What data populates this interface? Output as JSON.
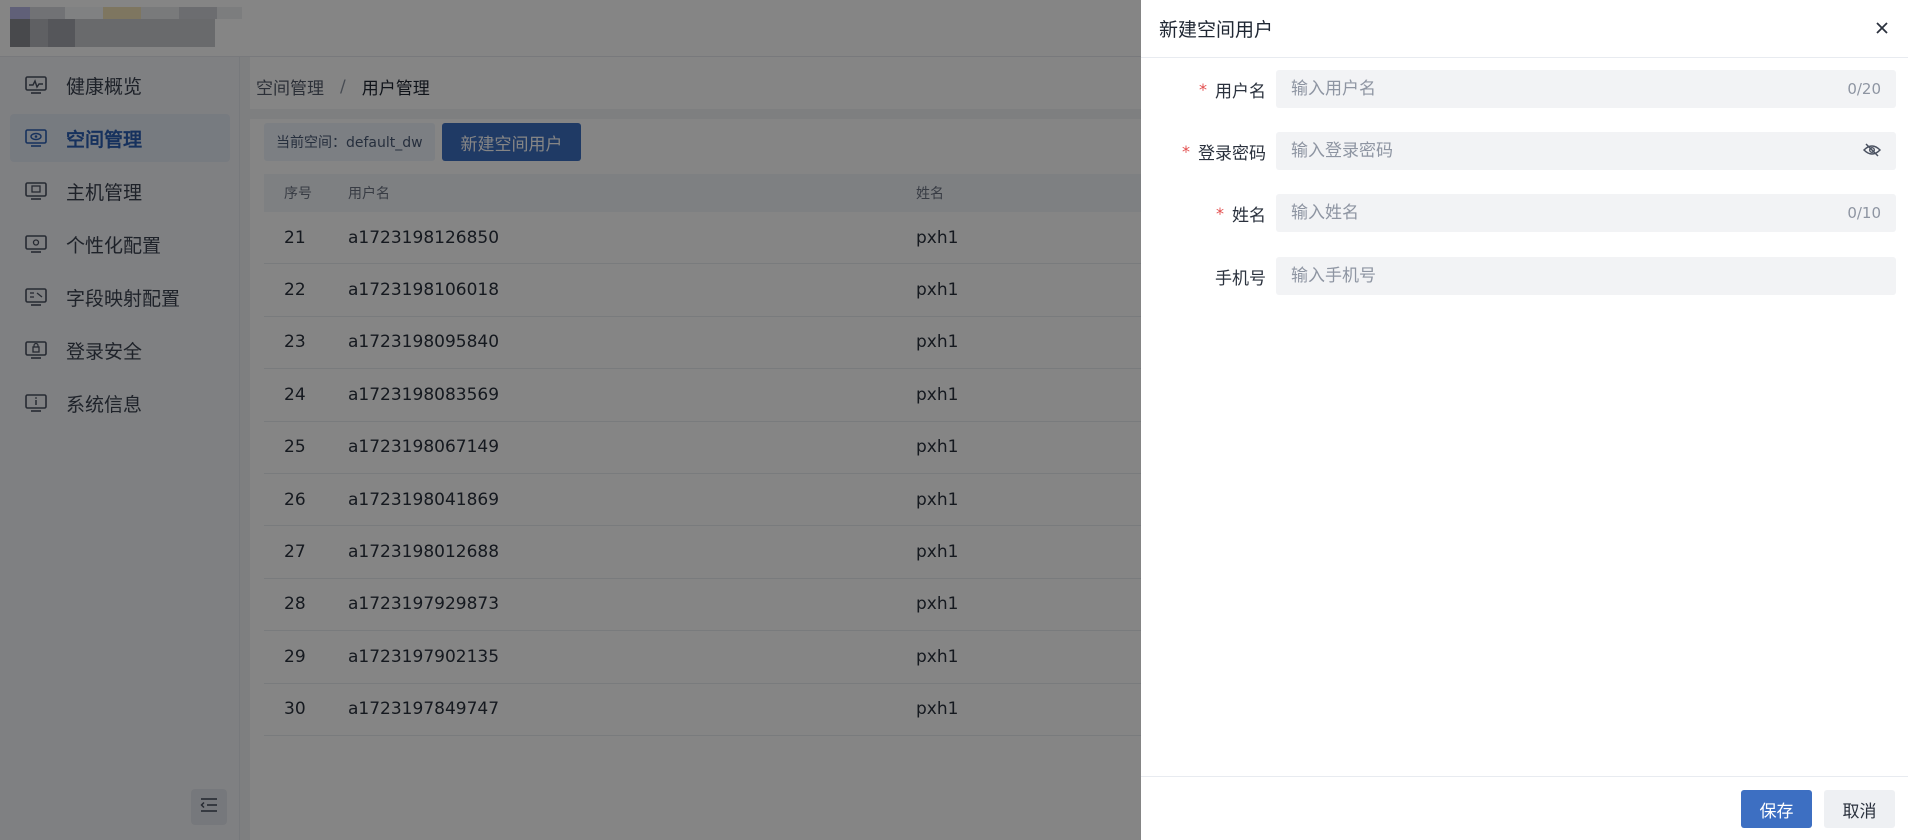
{
  "sidebar": {
    "items": [
      {
        "label": "健康概览",
        "icon": "monitor-pulse-icon"
      },
      {
        "label": "空间管理",
        "icon": "eye-screen-icon",
        "active": true
      },
      {
        "label": "主机管理",
        "icon": "host-monitor-icon"
      },
      {
        "label": "个性化配置",
        "icon": "config-monitor-icon"
      },
      {
        "label": "字段映射配置",
        "icon": "mapping-monitor-icon"
      },
      {
        "label": "登录安全",
        "icon": "security-monitor-icon"
      },
      {
        "label": "系统信息",
        "icon": "info-monitor-icon"
      }
    ],
    "collapse_icon": "collapse-menu-icon"
  },
  "breadcrumb": {
    "items": [
      "空间管理",
      "用户管理"
    ],
    "separator": "/"
  },
  "toolbar": {
    "current_space": "当前空间：default_dw",
    "new_user_button": "新建空间用户"
  },
  "table": {
    "columns": [
      "序号",
      "用户名",
      "姓名"
    ],
    "rows": [
      [
        "21",
        "a1723198126850",
        "pxh1"
      ],
      [
        "22",
        "a1723198106018",
        "pxh1"
      ],
      [
        "23",
        "a1723198095840",
        "pxh1"
      ],
      [
        "24",
        "a1723198083569",
        "pxh1"
      ],
      [
        "25",
        "a1723198067149",
        "pxh1"
      ],
      [
        "26",
        "a1723198041869",
        "pxh1"
      ],
      [
        "27",
        "a1723198012688",
        "pxh1"
      ],
      [
        "28",
        "a1723197929873",
        "pxh1"
      ],
      [
        "29",
        "a1723197902135",
        "pxh1"
      ],
      [
        "30",
        "a1723197849747",
        "pxh1"
      ]
    ]
  },
  "drawer": {
    "title": "新建空间用户",
    "fields": [
      {
        "label": "用户名",
        "required": true,
        "placeholder": "输入用户名",
        "counter": "0/20"
      },
      {
        "label": "登录密码",
        "required": true,
        "placeholder": "输入登录密码",
        "icon": "eye-hidden-icon"
      },
      {
        "label": "姓名",
        "required": true,
        "placeholder": "输入姓名",
        "counter": "0/10"
      },
      {
        "label": "手机号",
        "required": false,
        "placeholder": "输入手机号"
      }
    ],
    "save_label": "保存",
    "cancel_label": "取消"
  },
  "colors": {
    "primary": "#3d6fc2",
    "required": "#e34d4d",
    "overlay": "rgba(0,0,0,0.48)"
  }
}
